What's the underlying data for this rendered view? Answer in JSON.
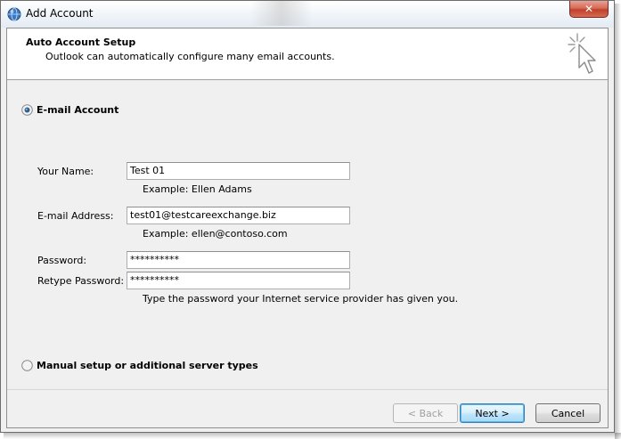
{
  "window": {
    "title": "Add Account",
    "close_label": "✕"
  },
  "header": {
    "title": "Auto Account Setup",
    "subtitle": "Outlook can automatically configure many email accounts."
  },
  "email_account": {
    "label": "E-mail Account",
    "selected": true,
    "your_name": {
      "label": "Your Name:",
      "value": "Test 01",
      "hint": "Example: Ellen Adams"
    },
    "email_address": {
      "label": "E-mail Address:",
      "value": "test01@testcareexchange.biz",
      "hint": "Example: ellen@contoso.com"
    },
    "password": {
      "label": "Password:",
      "value": "**********"
    },
    "retype_password": {
      "label": "Retype Password:",
      "value": "**********",
      "hint": "Type the password your Internet service provider has given you."
    }
  },
  "manual_setup": {
    "label": "Manual setup or additional server types",
    "selected": false
  },
  "buttons": {
    "back": "< Back",
    "next": "Next >",
    "cancel": "Cancel"
  }
}
